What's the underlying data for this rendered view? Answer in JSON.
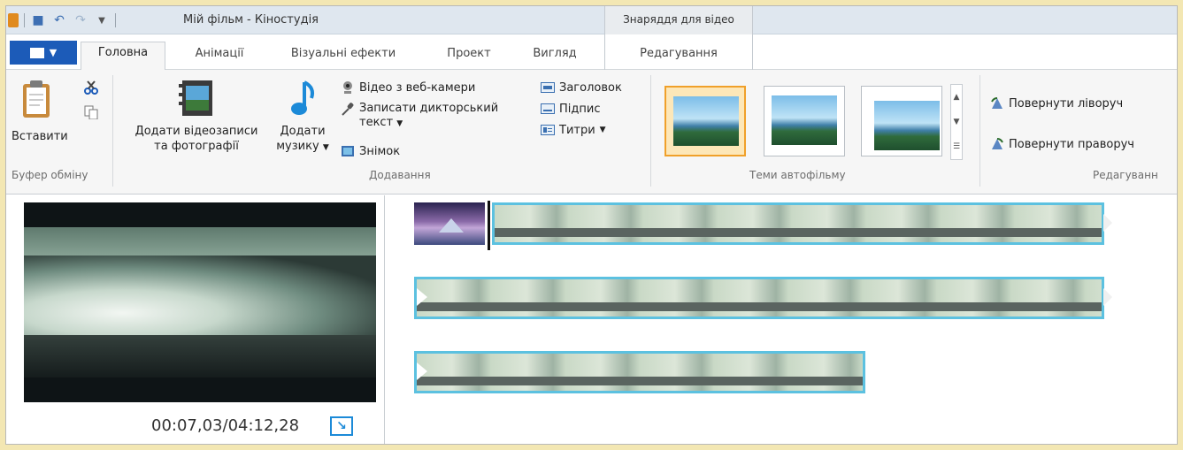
{
  "window": {
    "title": "Мій фільм - Кіностудія",
    "context_tab_header": "Знаряддя для відео"
  },
  "tabs": [
    {
      "label": "Головна",
      "active": true
    },
    {
      "label": "Анімації",
      "active": false
    },
    {
      "label": "Візуальні ефекти",
      "active": false
    },
    {
      "label": "Проект",
      "active": false
    },
    {
      "label": "Вигляд",
      "active": false
    },
    {
      "label": "Редагування",
      "active": false
    }
  ],
  "ribbon": {
    "clipboard": {
      "paste": "Вставити",
      "group_label": "Буфер обміну"
    },
    "add": {
      "add_videos_line1": "Додати відеозаписи",
      "add_videos_line2": "та фотографії",
      "add_music_line1": "Додати",
      "add_music_line2": "музику",
      "webcam": "Відео з веб-камери",
      "narration_line1": "Записати дикторський",
      "narration_line2": "текст",
      "snapshot": "Знімок",
      "title": "Заголовок",
      "caption": "Підпис",
      "credits": "Титри",
      "group_label": "Додавання"
    },
    "themes": {
      "group_label": "Теми автофільму"
    },
    "editing": {
      "rotate_left": "Повернути ліворуч",
      "rotate_right": "Повернути праворуч",
      "group_label": "Редагуванн"
    }
  },
  "preview": {
    "timecode": "00:07,03/04:12,28"
  },
  "colors": {
    "accent": "#1c5bb8",
    "clip_border": "#5cc1e0",
    "theme_selected": "#f0a02a"
  }
}
